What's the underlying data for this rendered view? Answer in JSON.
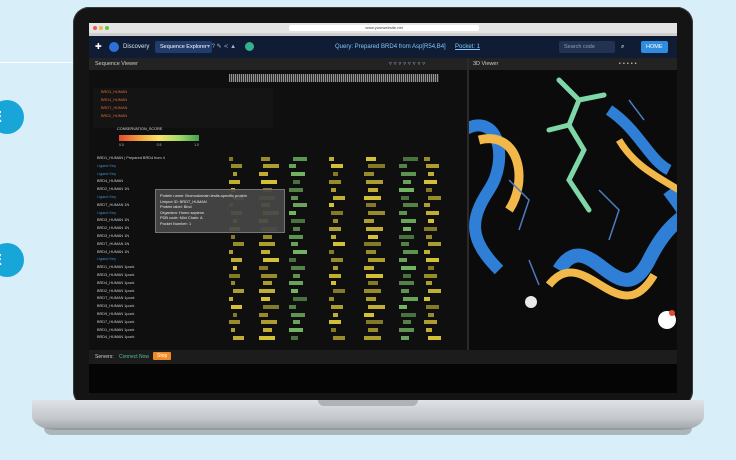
{
  "background_bubbles": [
    {
      "text": "E"
    },
    {
      "text": "E"
    }
  ],
  "browser": {
    "url": "www.yourwebsite.net"
  },
  "app": {
    "brand": "Discovery",
    "workspace_tab": "Sequence Explorer",
    "query_text": "Query: Prepared BRD4 from Asp[R54,B4]",
    "pocket_text": "Pocket: 1",
    "search_placeholder": "Search code",
    "home_button": "HOME"
  },
  "panels": {
    "sequence_title": "Sequence Viewer",
    "viewer_title": "3D Viewer"
  },
  "sequence": {
    "header_labels": [
      "BRD3_HUMAN",
      "BRD4_HUMAN",
      "BRDT_HUMAN",
      "BRD2_HUMAN"
    ],
    "legend_label": "CONSERVATION_SCORE",
    "legend_ticks": [
      "0.0",
      "0.5",
      "1.0"
    ],
    "rows": [
      "BRD1_HUMAN | Prepared BRD4 from 4",
      "Ligand Key",
      "Ligand Key",
      "BRD4_HUMAN",
      "BRD2_HUMAN 1N",
      "Ligand Key",
      "BRDT_HUMAN 1N",
      "Ligand Key",
      "BRD3_HUMAN 1N",
      "BRD2_HUMAN 1N",
      "BRD3_HUMAN 1N",
      "BRDT_HUMAN 1N",
      "BRD4_HUMAN 1N",
      "Ligand Key",
      "BRD1_HUMAN 1pock",
      "BRD3_HUMAN 1pock",
      "BRD4_HUMAN 1pock",
      "BRD2_HUMAN 1pock",
      "BRDT_HUMAN 1pock",
      "BRD3_HUMAN 1pock",
      "BRD9_HUMAN 1pock",
      "BRD7_HUMAN 1pock",
      "BRD1_HUMAN 1pock",
      "BRD4_HUMAN 1pock"
    ],
    "tooltip": {
      "lines": [
        "Protein name: Bromodomain testis-specific protein",
        "Uniprot ID: BRDT_HUMAN",
        "Protein label: Bind",
        "Organism: Homo sapiens",
        "PDB code: Mini Chain: A",
        "Pocket Number: 1"
      ]
    }
  },
  "footer": {
    "servers_label": "Servers:",
    "status_text": "Connect Now",
    "action_button": "Stop"
  },
  "colors": {
    "accent_blue": "#18a6d9",
    "appbar": "#0f1c33",
    "sequence_yellow": "#e6d23a",
    "sequence_green": "#7cc46a",
    "label_orange": "#e3683a",
    "protein_blue": "#2f7fd6",
    "protein_gold": "#f2b94a",
    "ligand_green": "#7fd6a6"
  }
}
